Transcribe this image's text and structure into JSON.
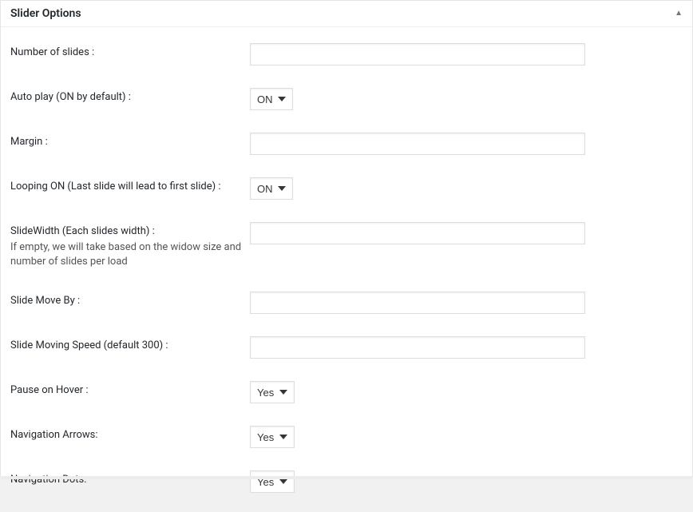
{
  "panel": {
    "title": "Slider Options"
  },
  "fields": {
    "number_of_slides": {
      "label": "Number of slides :",
      "value": ""
    },
    "autoplay": {
      "label": "Auto play (ON by default) :",
      "value": "ON"
    },
    "margin": {
      "label": "Margin :",
      "value": ""
    },
    "looping": {
      "label": "Looping ON (Last slide will lead to first slide) :",
      "value": "ON"
    },
    "slidewidth": {
      "label": "SlideWidth (Each slides width) :",
      "value": "",
      "help": "If empty, we will take based on the widow size and number of slides per load"
    },
    "slide_move_by": {
      "label": "Slide Move By :",
      "value": ""
    },
    "slide_speed": {
      "label": "Slide Moving Speed (default 300) :",
      "value": ""
    },
    "pause_on_hover": {
      "label": "Pause on Hover :",
      "value": "Yes"
    },
    "nav_arrows": {
      "label": "Navigation Arrows:",
      "value": "Yes"
    },
    "nav_dots": {
      "label": "Navigation Dots:",
      "value": "Yes"
    }
  }
}
